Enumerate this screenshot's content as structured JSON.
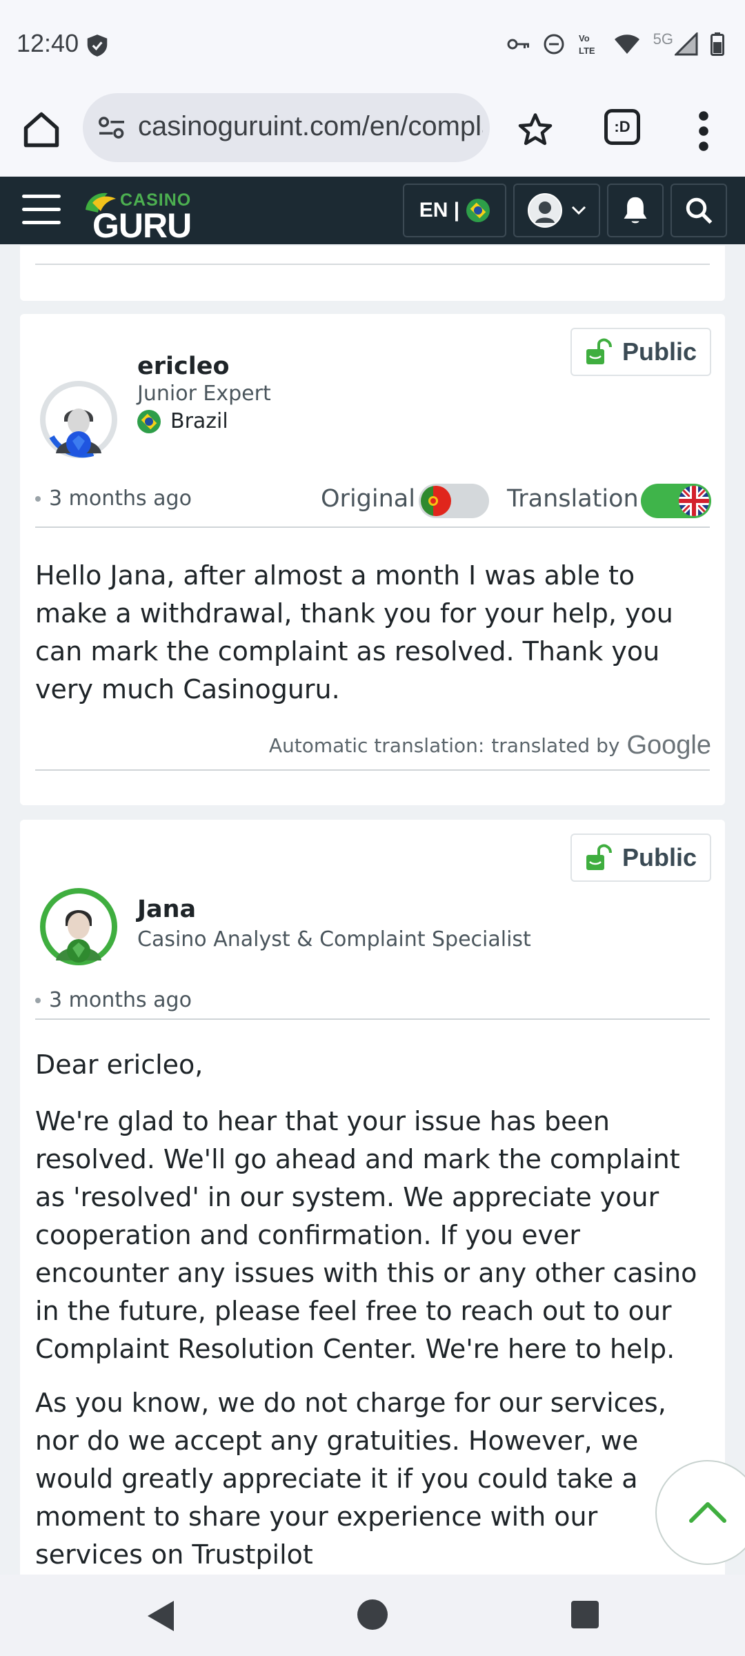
{
  "status_bar": {
    "time": "12:40",
    "network": "5G"
  },
  "browser": {
    "url": "casinoguruint.com/en/complaints",
    "tabs_label": ":D"
  },
  "site_header": {
    "logo_top": "CASINO",
    "logo_bottom": "GURU",
    "language": "EN |"
  },
  "posts": [
    {
      "visibility": "Public",
      "author": "ericleo",
      "role": "Junior Expert",
      "country": "Brazil",
      "time": "3 months ago",
      "original_label": "Original",
      "translation_label": "Translation",
      "original_enabled": false,
      "translation_enabled": true,
      "body": "Hello Jana, after almost a month I was able to make a withdrawal, thank you for your help, you can mark the complaint as resolved. Thank you very much Casinoguru.",
      "translation_note": "Automatic translation:",
      "translated_by": "translated by",
      "provider": "Google"
    },
    {
      "visibility": "Public",
      "author": "Jana",
      "role": "Casino Analyst & Complaint Specialist",
      "time": "3 months ago",
      "greeting": "Dear ericleo,",
      "paragraph1": "We're glad to hear that your issue has been resolved. We'll go ahead and mark the complaint as 'resolved' in our system. We appreciate your cooperation and confirmation. If you ever encounter any issues with this or any other casino in the future, please feel free to reach out to our Complaint Resolution Center. We're here to help.",
      "paragraph2": "As you know, we do not charge for our services, nor do we accept any gratuities. However, we would greatly appreciate it if you could take a moment to share your experience with our services on Trustpilot"
    }
  ],
  "colors": {
    "header_bg": "#1c2a33",
    "accent_green": "#3fb44a",
    "brand_green": "#4caf50"
  }
}
